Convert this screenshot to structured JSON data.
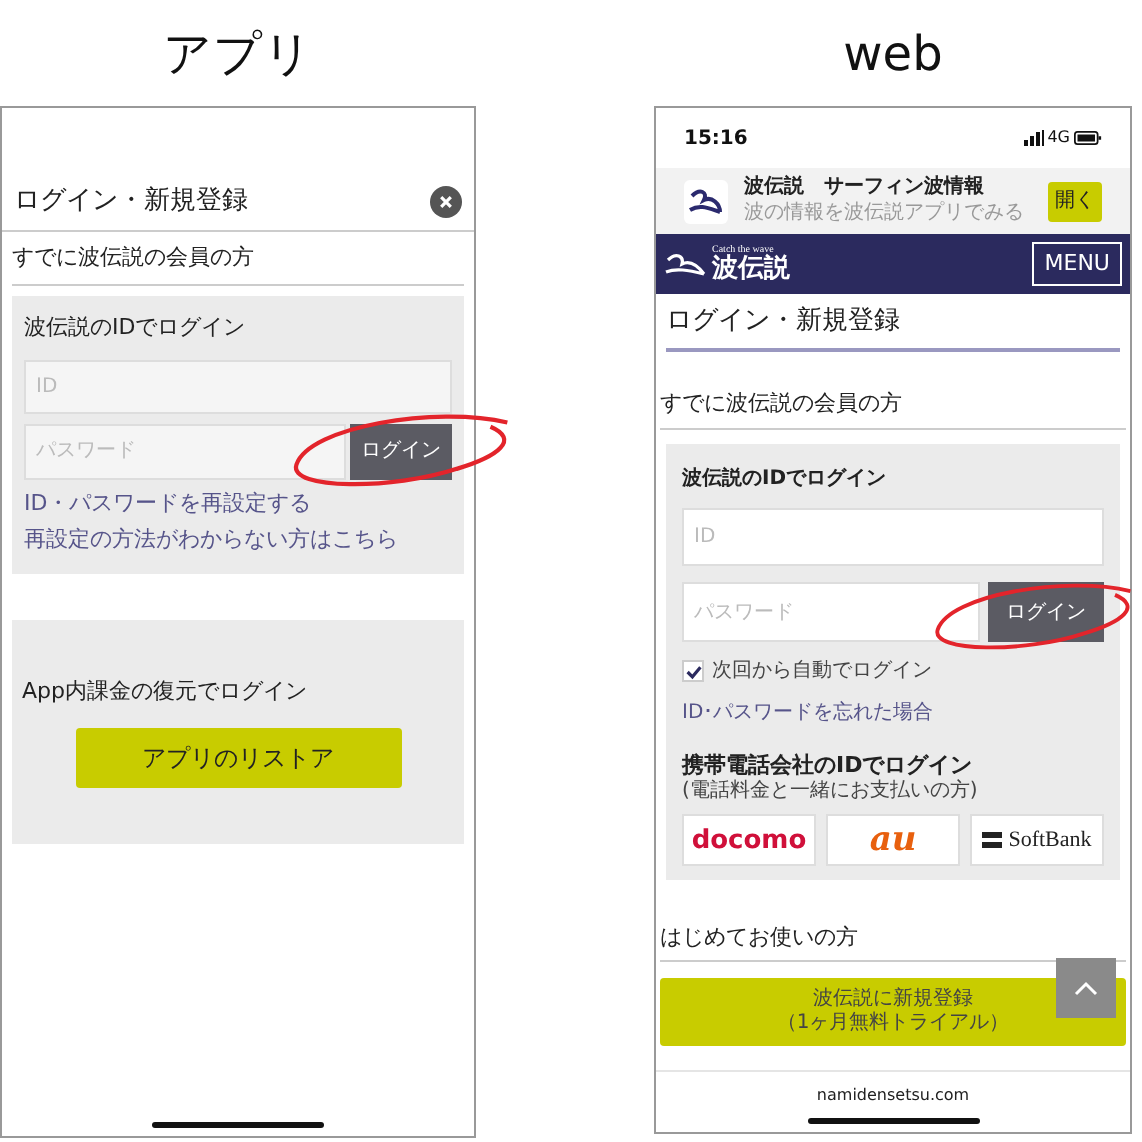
{
  "app_panel": {
    "caption": "アプリ",
    "title": "ログイン・新規登録",
    "section": "すでに波伝説の会員の方",
    "login_box": {
      "heading": "波伝説のIDでログイン",
      "id_field": {
        "placeholder": "ID"
      },
      "password_field": {
        "placeholder": "パスワード"
      },
      "login_button": "ログイン",
      "links": [
        "ID・パスワードを再設定する",
        "再設定の方法がわからない方はこちら"
      ]
    },
    "restore_box": {
      "text": "App内課金の復元でログイン",
      "button": "アプリのリストア"
    }
  },
  "web_panel": {
    "caption": "web",
    "status_bar": {
      "time": "15:16",
      "network": "4G"
    },
    "app_banner": {
      "title": "波伝説　サーフィン波情報",
      "subtitle": "波の情報を波伝説アプリでみる",
      "button": "開く"
    },
    "nav": {
      "tagline": "Catch the wave",
      "logo_text": "波伝説",
      "menu": "MENU"
    },
    "page_title": "ログイン・新規登録",
    "section": "すでに波伝説の会員の方",
    "login_box": {
      "heading": "波伝説のIDでログイン",
      "id_field": {
        "placeholder": "ID"
      },
      "password_field": {
        "placeholder": "パスワード"
      },
      "login_button": "ログイン",
      "remember": {
        "label": "次回から自動でログイン",
        "checked": true
      },
      "link": "ID･パスワードを忘れた場合"
    },
    "carrier_login": {
      "heading": "携帯電話会社のIDでログイン",
      "note": "(電話料金と一緒にお支払いの方)",
      "carriers": [
        {
          "kind": "docomo",
          "label": "docomo"
        },
        {
          "kind": "au",
          "label": "au"
        },
        {
          "kind": "softbank",
          "label": "SoftBank"
        }
      ]
    },
    "new_user": {
      "section": "はじめてお使いの方",
      "button_lines": [
        "波伝説に新規登録",
        "（1ヶ月無料トライアル）"
      ]
    },
    "footer": "namidensetsu.com"
  }
}
